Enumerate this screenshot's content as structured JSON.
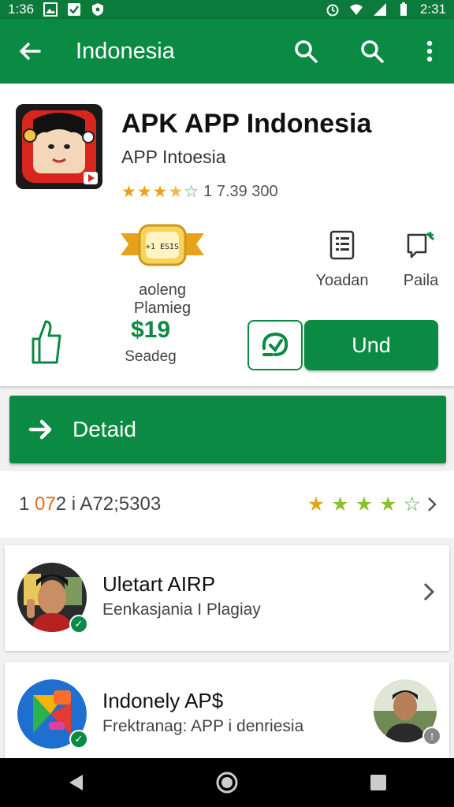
{
  "status_bar": {
    "time_left": "1:36",
    "time_right": "2:31",
    "icons_left": [
      "image-icon",
      "check-icon",
      "shield-icon"
    ],
    "icons_right": [
      "alarm-icon",
      "wifi-icon",
      "signal-icon",
      "battery-icon"
    ]
  },
  "app_bar": {
    "title": "Indonesia",
    "back_icon": "back-arrow-icon",
    "actions": [
      "search-icon",
      "search-icon",
      "more-vert-icon"
    ]
  },
  "app": {
    "name": "APK APP Indonesia",
    "developer": "APP Intoesia",
    "rating_text": "1 7.39 300",
    "stars": 3.5,
    "badge_text": "+1 ESIS",
    "badge_label": "aoleng Plamieg",
    "features": [
      {
        "label": "Yoadan",
        "icon": "document-icon"
      },
      {
        "label": "Paila",
        "icon": "chat-edit-icon"
      }
    ],
    "price": "$19",
    "price_sub": "Seadeg",
    "install_label": "Und"
  },
  "detail": {
    "label": "Detaid"
  },
  "stats": {
    "prefix": "1 ",
    "highlight": "07",
    "rest": "2 i A72;5303",
    "stars": 4.5
  },
  "list": [
    {
      "title": "Uletart AIRP",
      "subtitle": "Eenkasjania I Plagiay",
      "has_chevron": true
    },
    {
      "title": "Indonely AP$",
      "subtitle": "Frektranag: APP i denriesia",
      "has_chevron": false
    }
  ],
  "colors": {
    "primary": "#0b8a43",
    "status_bar": "#0b7a3b",
    "star": "#e8a21a",
    "accent_orange": "#e06a1a"
  }
}
